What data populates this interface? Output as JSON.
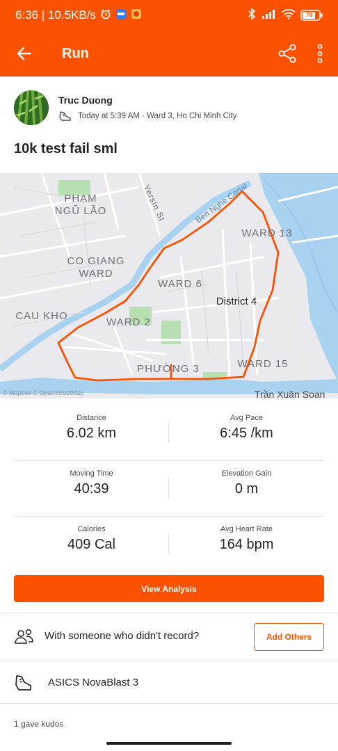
{
  "status_bar": {
    "time_speed": "6:36 | 10.5KB/s",
    "battery": "76",
    "icons": [
      "alarm-icon",
      "zalo-icon",
      "app-icon",
      "bluetooth-icon",
      "signal-icon",
      "wifi-icon",
      "battery-icon"
    ]
  },
  "app_bar": {
    "title": "Run",
    "icons": [
      "back-arrow-icon",
      "share-icon",
      "more-vertical-icon"
    ]
  },
  "athlete": {
    "name": "Truc Duong",
    "meta": "Today at 5:39 AM · Ward 3, Ho Chi Minh City",
    "activity_icon": "running-shoe-icon"
  },
  "activity": {
    "title": "10k test fail sml"
  },
  "map": {
    "labels": {
      "pham_ngu_lao": "PHẠM\nNGŨ LÃO",
      "yersin": "Yersin St",
      "ben_nghe": "Ben Nghe Canal",
      "ward13": "WARD 13",
      "co_giang": "CO GIANG\nWARD",
      "ward6": "WARD 6",
      "district4": "District 4",
      "cau_kho": "CAU KHO",
      "ward2": "WARD 2",
      "phuong3": "PHƯỜNG 3",
      "ward15": "WARD 15",
      "tran_xuan_soan": "Trần Xuân Soạn",
      "attribution": "© Mapbox © OpenStreetMap"
    },
    "route_color": "#fc5200",
    "water_color": "#a9d2f0"
  },
  "stats": [
    [
      {
        "label": "Distance",
        "value": "6.02 km"
      },
      {
        "label": "Avg Pace",
        "value": "6:45 /km"
      }
    ],
    [
      {
        "label": "Moving Time",
        "value": "40:39"
      },
      {
        "label": "Elevation Gain",
        "value": "0 m"
      }
    ],
    [
      {
        "label": "Calories",
        "value": "409 Cal"
      },
      {
        "label": "Avg Heart Rate",
        "value": "164 bpm"
      }
    ]
  ],
  "actions": {
    "view_analysis": "View Analysis",
    "with_someone": "With someone who didn't record?",
    "add_others": "Add Others",
    "gear": "ASICS NovaBlast 3",
    "kudos": "1 gave kudos"
  },
  "colors": {
    "brand": "#fc5200",
    "text": "#242428",
    "muted": "#494950"
  }
}
